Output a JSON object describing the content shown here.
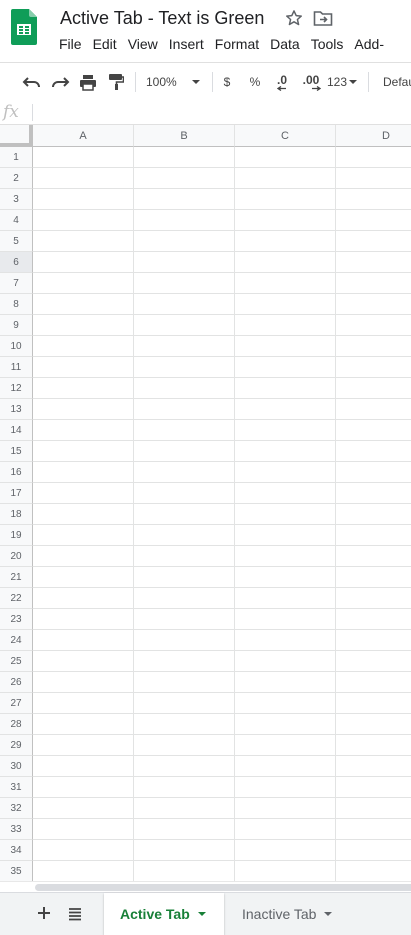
{
  "document": {
    "title": "Active Tab - Text is Green"
  },
  "menu": [
    "File",
    "Edit",
    "View",
    "Insert",
    "Format",
    "Data",
    "Tools",
    "Add-"
  ],
  "toolbar": {
    "zoom": "100%",
    "currency": "$",
    "percent": "%",
    "dec_decrease": ".0",
    "dec_increase": ".00",
    "more_formats": "123",
    "font": "Defau"
  },
  "formula": {
    "fx_label": "fx",
    "value": ""
  },
  "columns": [
    "A",
    "B",
    "C",
    "D"
  ],
  "rows": [
    "1",
    "2",
    "3",
    "4",
    "5",
    "6",
    "7",
    "8",
    "9",
    "10",
    "11",
    "12",
    "13",
    "14",
    "15",
    "16",
    "17",
    "18",
    "19",
    "20",
    "21",
    "22",
    "23",
    "24",
    "25",
    "26",
    "27",
    "28",
    "29",
    "30",
    "31",
    "32",
    "33",
    "34",
    "35"
  ],
  "selected_row": "6",
  "sheets": [
    {
      "name": "Active Tab",
      "active": true
    },
    {
      "name": "Inactive Tab",
      "active": false
    }
  ],
  "colors": {
    "active_tab_text": "#188038",
    "logo_green": "#0f9d58"
  }
}
